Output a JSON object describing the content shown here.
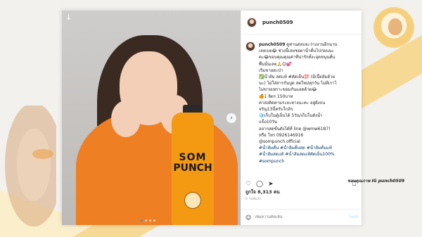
{
  "post": {
    "username": "punch0509",
    "caption_lines": [
      {
        "kind": "first",
        "user": "punch0509",
        "text": " ดูท่านต่ลบจะว่างงานอีกนาน"
      },
      {
        "kind": "plain",
        "text": "เลยเบย😂 ช่วงนี้เลยชอยาน้ำคั้นไปก่อนนะ"
      },
      {
        "kind": "plain",
        "text": "คะ😂ขอบคุณคุณค่าที่น่ารักทั้งะอุดหนุนคั้น"
      },
      {
        "kind": "plain",
        "text": "พื้นนั้นเลย🙏😊💕"
      },
      {
        "kind": "plain",
        "text": "เริ่มขายตะป่า"
      },
      {
        "kind": "plain",
        "text": "✅น้ำส้ม สดแท้ #คัดเย็น💯 (มีเนื้อส้มด้วย"
      },
      {
        "kind": "plain",
        "text": "นะ) ไม่ใส่สารกันบูด สดใหม่ทุกวัน ไม่ตีเราไ"
      },
      {
        "kind": "plain",
        "text": "ไม่ขายเพราะขอมกันแอดด้วย😂"
      },
      {
        "kind": "plain",
        "text": "🍊1 ลิตร 150บาท"
      },
      {
        "kind": "plain",
        "text": "ค่าส่งคิดตามระยะทางนะคะ อยู่ฝั่งธน"
      },
      {
        "kind": "plain",
        "text": "จรัญ13นี้ครับใกล้ๆ"
      },
      {
        "kind": "plain",
        "text": "🧊เก็บในตู้เย็นได้ 5วัน/เก็บในตังน้ำ"
      },
      {
        "kind": "plain",
        "text": "แข็ง10วัน"
      },
      {
        "kind": "plain",
        "text": "อยากสดขั้นดั่งได้ที่ line @wmw6187)"
      },
      {
        "kind": "plain",
        "text": "หรือ โทร 0926146916"
      },
      {
        "kind": "plain",
        "text": "@sompunch.official"
      },
      {
        "kind": "blank",
        "text": " "
      },
      {
        "kind": "tag",
        "text": "#น้ำส้มคั้น #น้ำส้มคั้นสด #น้ำส้มคั้นแท้"
      },
      {
        "kind": "tag",
        "text": "#น้ำส้มสดแท้ #น้ำส้มสดแท้คัดเย็น100%"
      },
      {
        "kind": "tag",
        "text": "#sompunch"
      }
    ],
    "likes": "ถูกใจ 8,313 คน",
    "posted": "6 วันที่แล้ว",
    "comment_placeholder": "เพิ่มความคิดเห็น",
    "post_button": "โพสต์"
  },
  "bottle": {
    "line1": "SOM",
    "line2": "PUNCH"
  },
  "credit": "ขอบคุณภาพ IG punch0509",
  "icons": [
    "download-icon",
    "next-arrow-icon",
    "heart-icon",
    "comment-icon",
    "share-icon",
    "bookmark-icon",
    "emoji-icon"
  ],
  "colors": {
    "accent_orange": "#ee7f22",
    "link_blue": "#003569",
    "post_blue": "#b2dffc"
  }
}
